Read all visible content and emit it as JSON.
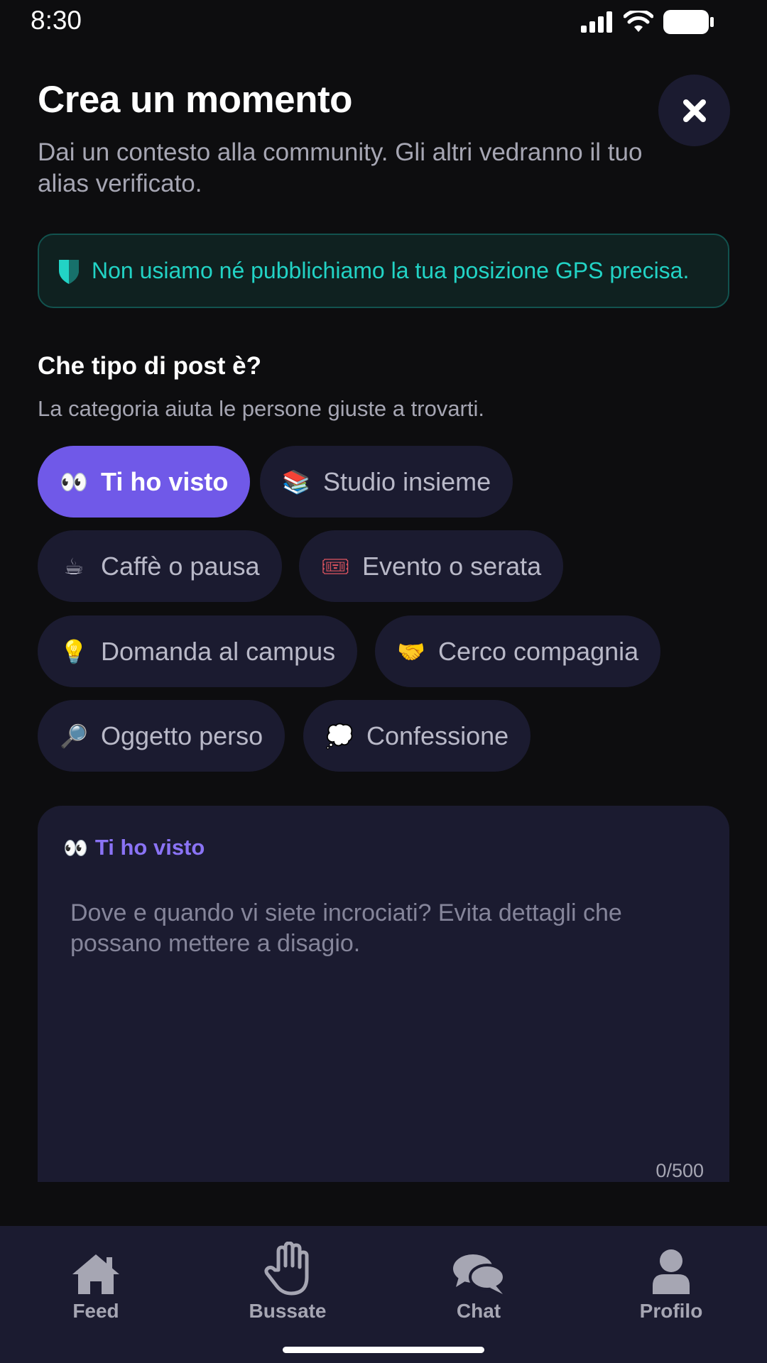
{
  "status": {
    "time": "8:30",
    "icons": [
      "signal-icon",
      "wifi-icon",
      "battery-icon"
    ]
  },
  "header": {
    "title": "Crea un momento",
    "subtitle": "Dai un contesto alla community. Gli altri vedranno il tuo alias verificato.",
    "close_icon": "close-icon"
  },
  "privacy": {
    "icon": "shield-icon",
    "text": "Non usiamo né pubblichiamo la tua posizione GPS precisa."
  },
  "category": {
    "title": "Che tipo di post è?",
    "subtitle": "La categoria aiuta le persone giuste a trovarti.",
    "chips": [
      {
        "emoji": "👀",
        "label": "Ti ho visto",
        "selected": true
      },
      {
        "emoji": "📚",
        "label": "Studio insieme",
        "selected": false
      },
      {
        "emoji": "☕",
        "label": "Caffè o pausa",
        "selected": false
      },
      {
        "emoji": "🎟",
        "label": "Evento o serata",
        "selected": false
      },
      {
        "emoji": "💡",
        "label": "Domanda al campus",
        "selected": false
      },
      {
        "emoji": "🤝",
        "label": "Cerco compagnia",
        "selected": false
      },
      {
        "emoji": "🔎",
        "label": "Oggetto perso",
        "selected": false
      },
      {
        "emoji": "💭",
        "label": "Confessione",
        "selected": false
      }
    ]
  },
  "composer": {
    "tag_emoji": "👀",
    "tag_label": "Ti ho visto",
    "value": "",
    "placeholder": "Dove e quando vi siete incrociati? Evita dettagli che possano mettere a disagio.",
    "counter": "0/500"
  },
  "nav": {
    "items": [
      {
        "label": "Feed",
        "icon": "home-icon"
      },
      {
        "label": "Bussate",
        "icon": "hand-icon"
      },
      {
        "label": "Chat",
        "icon": "chat-icon"
      },
      {
        "label": "Profilo",
        "icon": "user-icon"
      }
    ]
  },
  "colors": {
    "accent": "#7059e8",
    "surface": "#1b1b30",
    "background": "#0d0d0f",
    "privacy": "#22d3c5"
  }
}
